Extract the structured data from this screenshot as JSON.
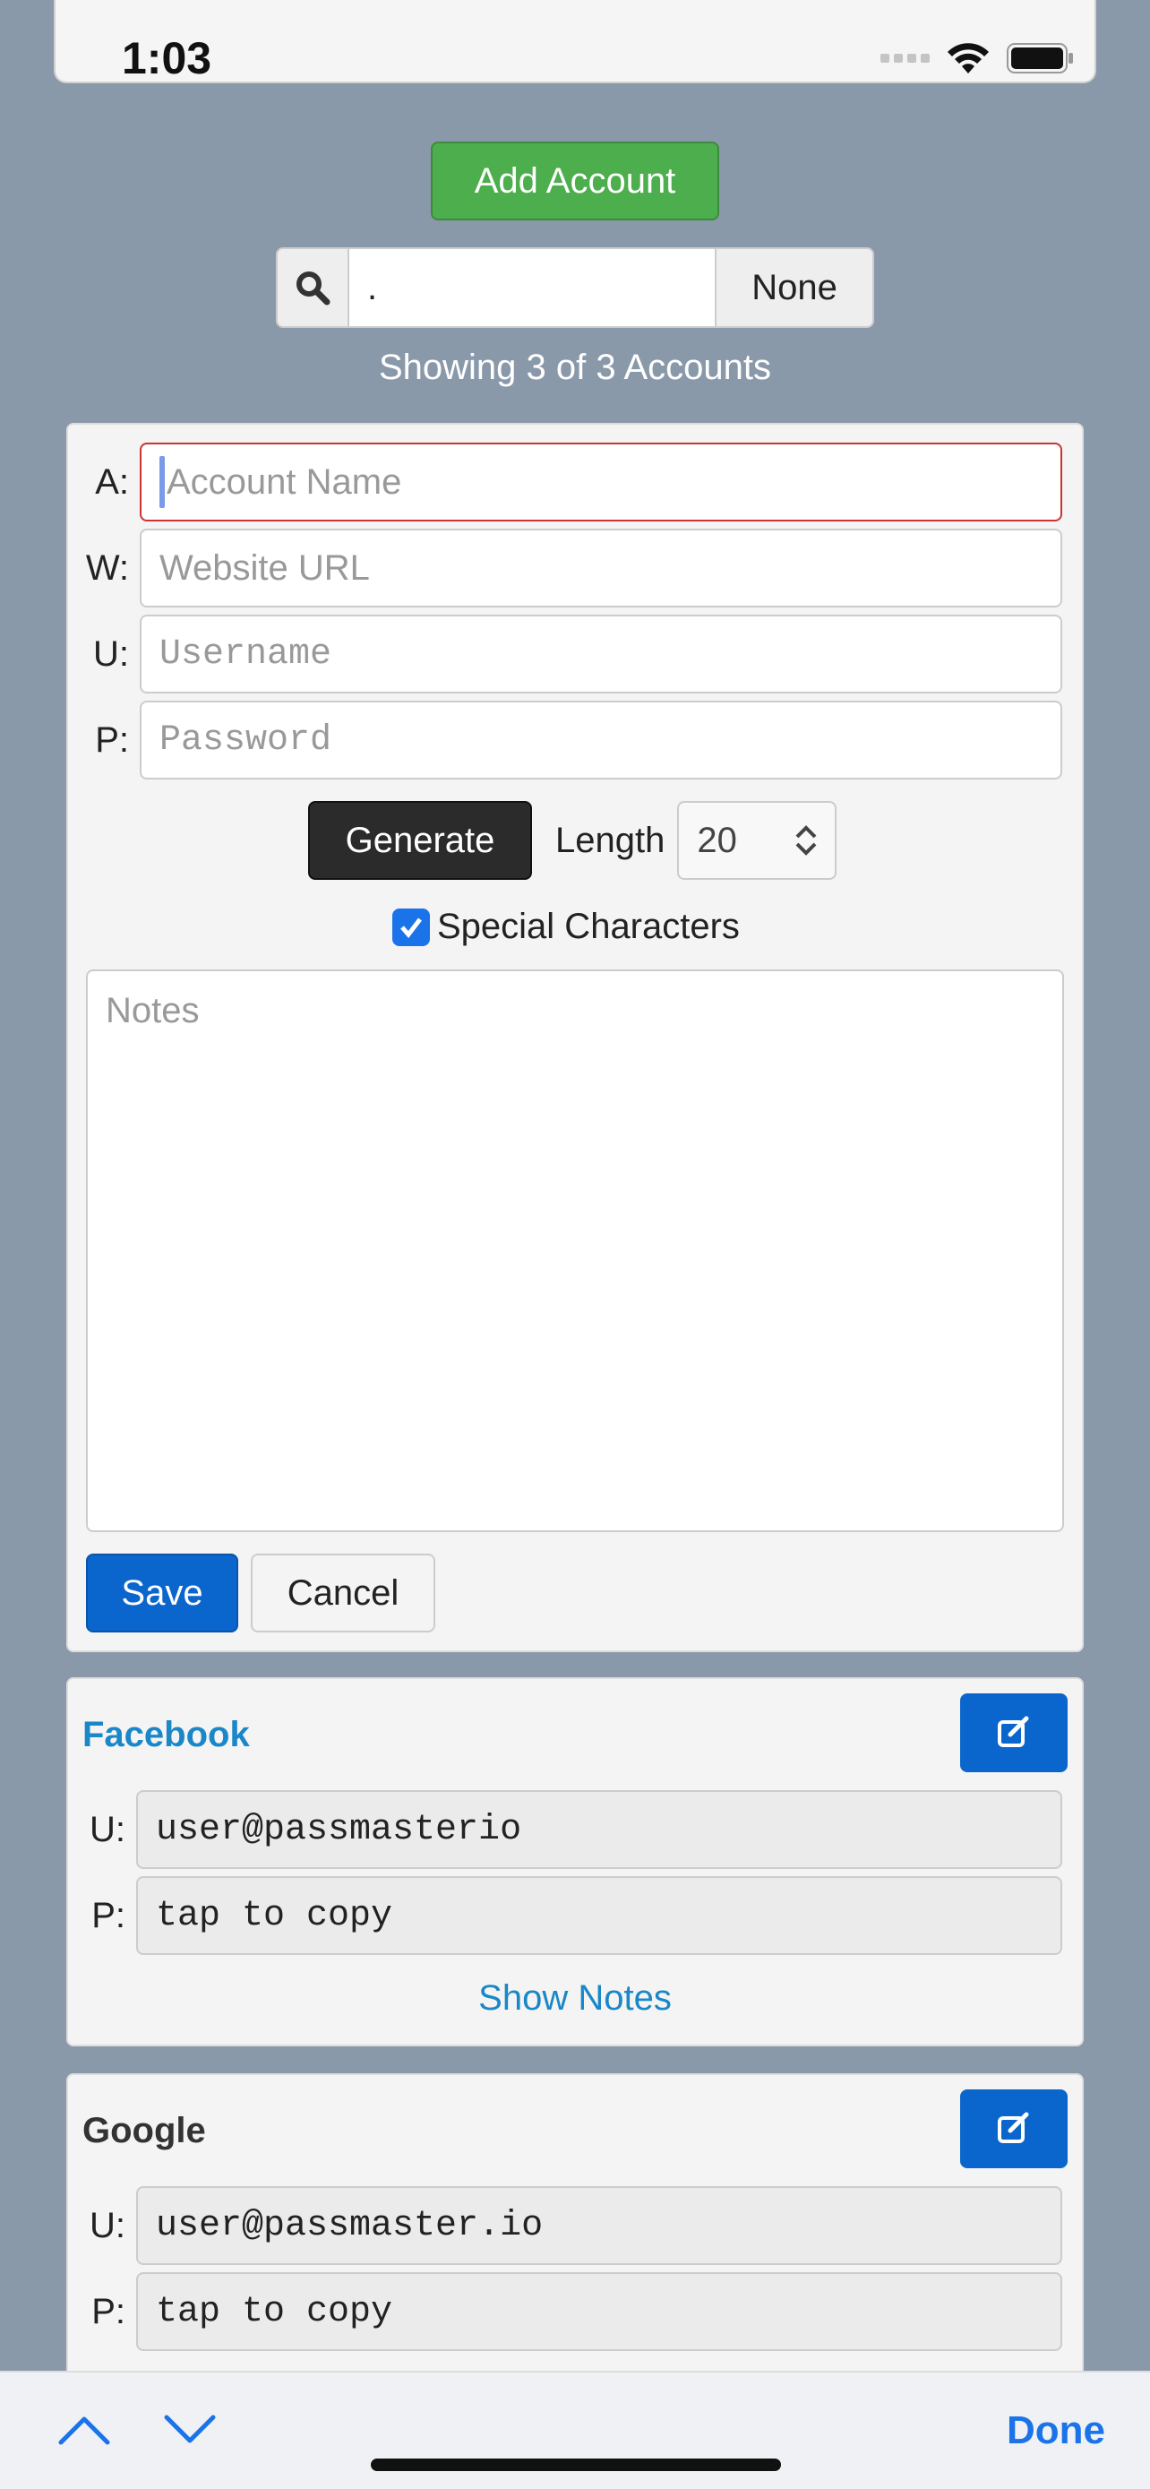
{
  "status": {
    "time": "1:03"
  },
  "toolbar": {
    "add_account_label": "Add Account",
    "search_value": ".",
    "none_label": "None",
    "showing_text": "Showing 3 of 3 Accounts"
  },
  "form": {
    "account_label": "A:",
    "account_placeholder": "Account Name",
    "website_label": "W:",
    "website_placeholder": "Website URL",
    "username_label": "U:",
    "username_placeholder": "Username",
    "password_label": "P:",
    "password_placeholder": "Password",
    "generate_label": "Generate",
    "length_label": "Length",
    "length_value": "20",
    "special_label": "Special Characters",
    "special_checked": true,
    "notes_placeholder": "Notes",
    "save_label": "Save",
    "cancel_label": "Cancel"
  },
  "accounts": [
    {
      "title": "Facebook",
      "title_color": "#1a87c8",
      "username_label": "U:",
      "username": "user@passmasterio",
      "password_label": "P:",
      "password": "tap to copy",
      "show_notes": "Show Notes"
    },
    {
      "title": "Google",
      "title_color": "#333333",
      "username_label": "U:",
      "username": "user@passmaster.io",
      "password_label": "P:",
      "password": "tap to copy"
    }
  ],
  "keyboard_bar": {
    "done_label": "Done"
  },
  "colors": {
    "background": "#8a99aa",
    "add_button": "#4cae4c",
    "primary": "#0a66cc",
    "link": "#1a87c8"
  }
}
